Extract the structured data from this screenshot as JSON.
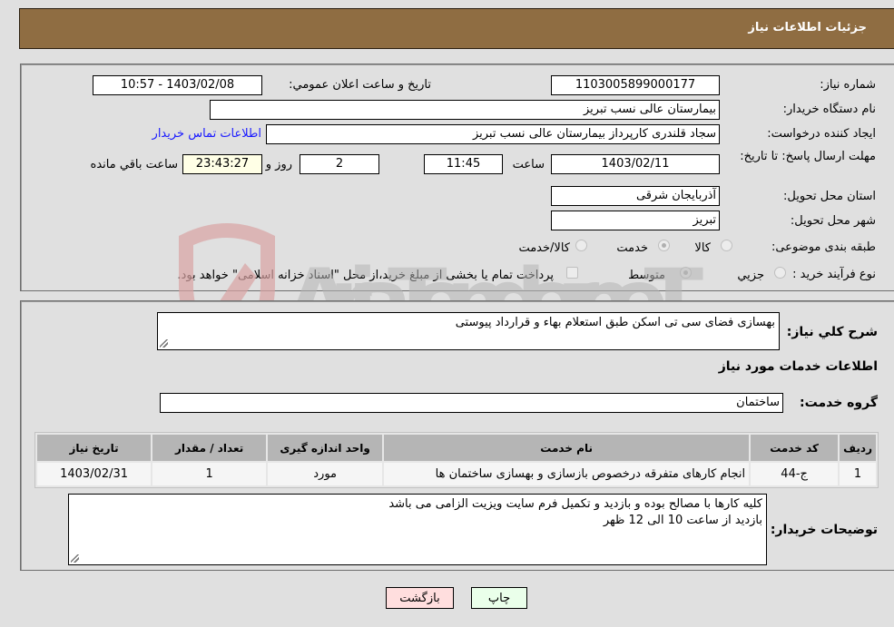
{
  "header": {
    "title": "جزئیات اطلاعات نیاز"
  },
  "form": {
    "need_number": {
      "label": "شماره نیاز:",
      "value": "1103005899000177"
    },
    "announce_datetime": {
      "label": "تاریخ و ساعت اعلان عمومي:",
      "value": "1403/02/08 - 10:57"
    },
    "buyer_org": {
      "label": "نام دستگاه خریدار:",
      "value": "بیمارستان عالی نسب تبریز"
    },
    "requester": {
      "label": "ایجاد کننده درخواست:",
      "value": "سجاد قلندری کارپرداز بیمارستان عالی نسب تبریز"
    },
    "buyer_contact_link": "اطلاعات تماس خریدار",
    "deadline": {
      "label": "مهلت ارسال پاسخ: تا تاریخ:",
      "date": "1403/02/11",
      "time_label": "ساعت",
      "time": "11:45",
      "days": "2",
      "days_label": "روز و",
      "remaining": "23:43:27",
      "remaining_label": "ساعت باقي مانده"
    },
    "province": {
      "label": "استان محل تحویل:",
      "value": "آذربایجان شرقی"
    },
    "city": {
      "label": "شهر محل تحویل:",
      "value": "تبریز"
    },
    "category": {
      "label": "طبقه بندی موضوعی:",
      "options": [
        "کالا",
        "خدمت",
        "کالا/خدمت"
      ],
      "selected": "خدمت"
    },
    "purchase_type": {
      "label": "نوع فرآیند خرید :",
      "options": [
        "جزیي",
        "متوسط"
      ],
      "selected": "متوسط",
      "treasury_note": "پرداخت تمام یا بخشی از مبلغ خرید،از محل \"اسناد خزانه اسلامی\" خواهد بود."
    }
  },
  "details": {
    "description_label": "شرح كلي نياز:",
    "description": "بهسازی فضای سی تی اسکن طبق استعلام بهاء و قرارداد پیوستی",
    "services_heading": "اطلاعات خدمات مورد نیاز",
    "service_group_label": "گروه خدمت:",
    "service_group": "ساختمان",
    "table": {
      "headers": [
        "ردیف",
        "کد خدمت",
        "نام خدمت",
        "واحد اندازه گیری",
        "تعداد / مقدار",
        "تاریخ نیاز"
      ],
      "rows": [
        [
          "1",
          "ج-44",
          "انجام کارهای متفرقه درخصوص بازسازی و بهسازی ساختمان ها",
          "مورد",
          "1",
          "1403/02/31"
        ]
      ]
    },
    "buyer_notes_label": "توضیحات خریدار:",
    "buyer_notes": [
      "کلیه کارها با مصالح بوده و بازدید و تکمیل فرم سایت ویزیت الزامی می باشد",
      "بازدید از ساعت 10 الی 12 ظهر"
    ]
  },
  "buttons": {
    "print": "چاپ",
    "back": "بازگشت"
  },
  "watermark": {
    "text": "AriaTender.neT"
  },
  "colors": {
    "header_bg": "#8f6d42",
    "link": "#1a1aff",
    "back_btn": "#ffdede",
    "print_btn": "#eaffea",
    "remaining_bg": "#ffffe6"
  }
}
